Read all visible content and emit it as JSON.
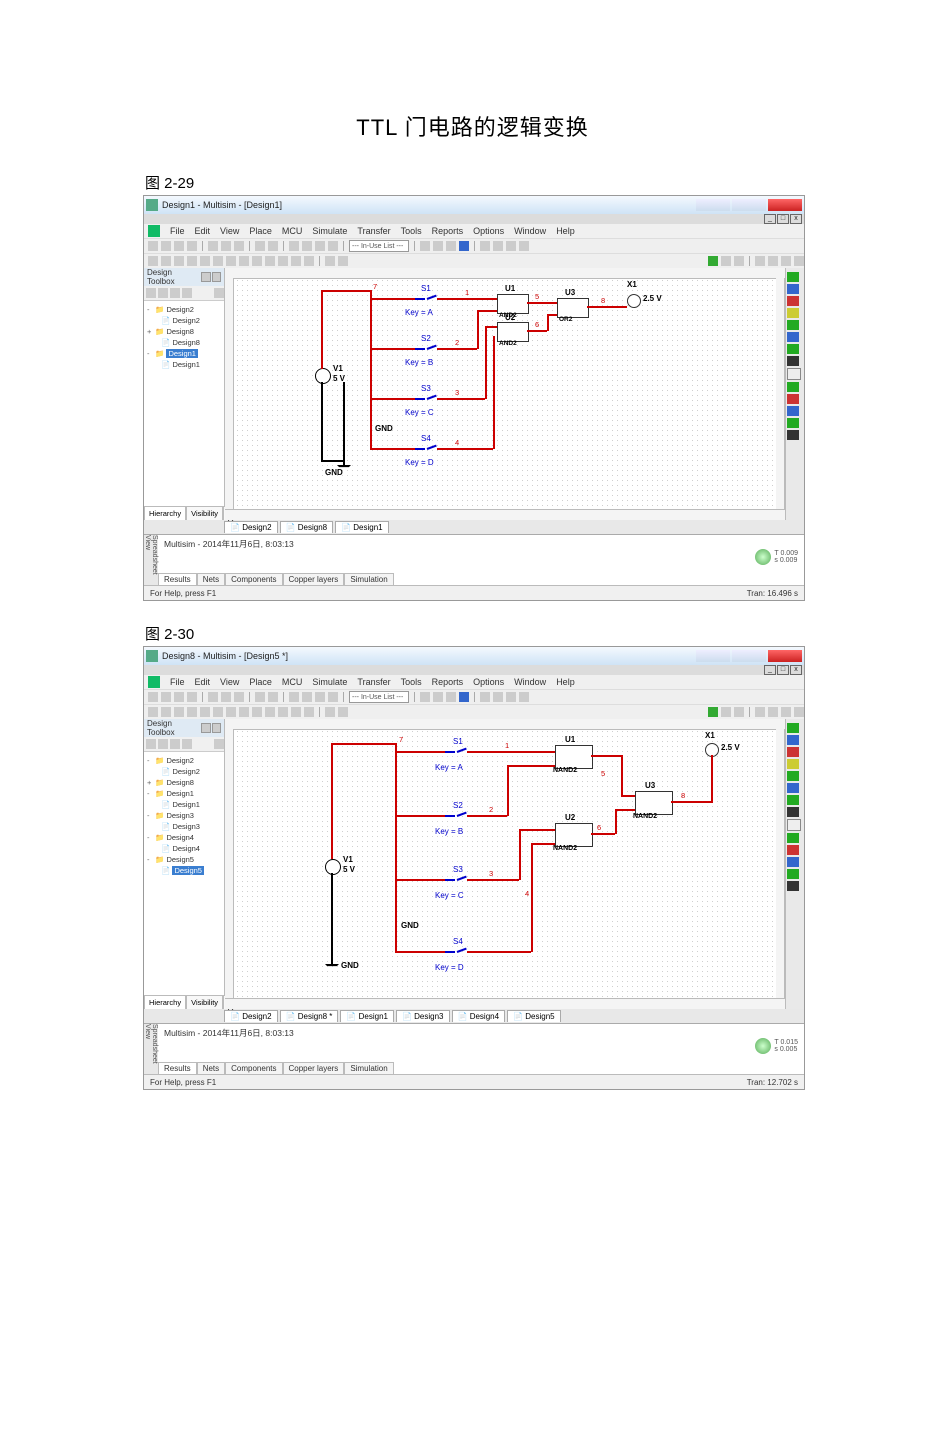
{
  "document": {
    "title": "TTL 门电路的逻辑变换",
    "figure1_caption": "图 2-29",
    "figure2_caption": "图 2-30"
  },
  "shot1": {
    "titlebar": "Design1 - Multisim - [Design1]",
    "menu": [
      "File",
      "Edit",
      "View",
      "Place",
      "MCU",
      "Simulate",
      "Transfer",
      "Tools",
      "Reports",
      "Options",
      "Window",
      "Help"
    ],
    "zoom_combo": "--- In-Use List ---",
    "sidebar": {
      "title": "Design Toolbox",
      "tree": [
        {
          "lvl": 0,
          "pm": "-",
          "txt": "Design2"
        },
        {
          "lvl": 1,
          "pm": "",
          "txt": "Design2"
        },
        {
          "lvl": 0,
          "pm": "+",
          "txt": "Design8"
        },
        {
          "lvl": 1,
          "pm": "",
          "txt": "Design8"
        },
        {
          "lvl": 0,
          "pm": "-",
          "txt": "Design1",
          "sel": true
        },
        {
          "lvl": 1,
          "pm": "",
          "txt": "Design1"
        }
      ],
      "tabs": [
        "Hierarchy",
        "Visibility",
        "Project View"
      ]
    },
    "canvas": {
      "switches": [
        {
          "id": "S1",
          "key": "Key = A"
        },
        {
          "id": "S2",
          "key": "Key = B"
        },
        {
          "id": "S3",
          "key": "Key = C"
        },
        {
          "id": "S4",
          "key": "Key = D"
        }
      ],
      "gates": [
        {
          "id": "U1",
          "type": "AND2"
        },
        {
          "id": "U2",
          "type": "AND2"
        },
        {
          "id": "U3",
          "type": "OR2"
        }
      ],
      "net_labels": [
        "1",
        "2",
        "3",
        "4",
        "5",
        "6",
        "7",
        "8"
      ],
      "source": {
        "id": "V1",
        "value": "5 V"
      },
      "probe": {
        "id": "X1",
        "value": "2.5 V"
      },
      "gnd": "GND"
    },
    "workspace_tabs": [
      "Design2",
      "Design8",
      "Design1"
    ],
    "spreadsheet": {
      "title": "Spreadsheet View",
      "log": "Multisim  -  2014年11月6日, 8:03:13",
      "tabs": [
        "Results",
        "Nets",
        "Components",
        "Copper layers",
        "Simulation"
      ],
      "led_t": "T 0.009",
      "led_s": "s 0.009"
    },
    "status_left": "For Help, press F1",
    "status_right": "Tran: 16.496 s"
  },
  "shot2": {
    "titlebar": "Design8 - Multisim - [Design5 *]",
    "menu": [
      "File",
      "Edit",
      "View",
      "Place",
      "MCU",
      "Simulate",
      "Transfer",
      "Tools",
      "Reports",
      "Options",
      "Window",
      "Help"
    ],
    "zoom_combo": "--- In-Use List ---",
    "sidebar": {
      "title": "Design Toolbox",
      "tree": [
        {
          "lvl": 0,
          "pm": "-",
          "txt": "Design2"
        },
        {
          "lvl": 1,
          "pm": "",
          "txt": "Design2"
        },
        {
          "lvl": 0,
          "pm": "+",
          "txt": "Design8"
        },
        {
          "lvl": 0,
          "pm": "-",
          "txt": "Design1"
        },
        {
          "lvl": 1,
          "pm": "",
          "txt": "Design1"
        },
        {
          "lvl": 0,
          "pm": "-",
          "txt": "Design3"
        },
        {
          "lvl": 1,
          "pm": "",
          "txt": "Design3"
        },
        {
          "lvl": 0,
          "pm": "-",
          "txt": "Design4"
        },
        {
          "lvl": 1,
          "pm": "",
          "txt": "Design4"
        },
        {
          "lvl": 0,
          "pm": "-",
          "txt": "Design5"
        },
        {
          "lvl": 1,
          "pm": "",
          "txt": "Design5",
          "sel": true
        }
      ],
      "tabs": [
        "Hierarchy",
        "Visibility",
        "Project View"
      ]
    },
    "canvas": {
      "switches": [
        {
          "id": "S1",
          "key": "Key = A"
        },
        {
          "id": "S2",
          "key": "Key = B"
        },
        {
          "id": "S3",
          "key": "Key = C"
        },
        {
          "id": "S4",
          "key": "Key = D"
        }
      ],
      "gates": [
        {
          "id": "U1",
          "type": "NAND2"
        },
        {
          "id": "U2",
          "type": "NAND2"
        },
        {
          "id": "U3",
          "type": "NAND2"
        }
      ],
      "net_labels": [
        "1",
        "2",
        "3",
        "4",
        "5",
        "6",
        "7",
        "8"
      ],
      "source": {
        "id": "V1",
        "value": "5 V"
      },
      "probe": {
        "id": "X1",
        "value": "2.5 V"
      },
      "gnd": "GND"
    },
    "workspace_tabs": [
      "Design2",
      "Design8 *",
      "Design1",
      "Design3",
      "Design4",
      "Design5"
    ],
    "spreadsheet": {
      "title": "Spreadsheet View",
      "log": "Multisim  -  2014年11月6日, 8:03:13",
      "tabs": [
        "Results",
        "Nets",
        "Components",
        "Copper layers",
        "Simulation"
      ],
      "led_t": "T 0.015",
      "led_s": "s 0.005"
    },
    "status_left": "For Help, press F1",
    "status_right": "Tran: 12.702 s"
  }
}
